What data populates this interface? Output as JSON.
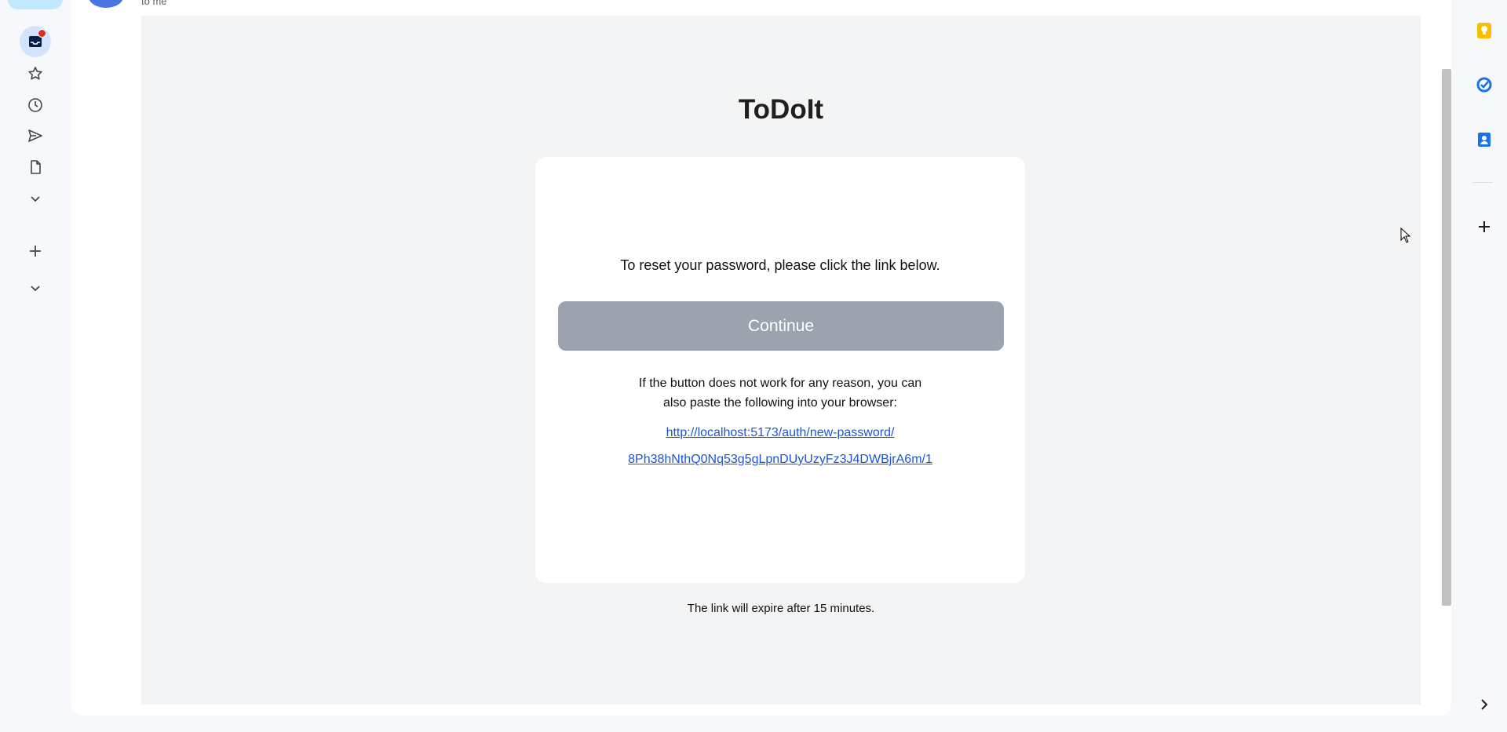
{
  "nav": {
    "items": [
      {
        "icon": "inbox-icon",
        "unread_dot": true
      },
      {
        "icon": "star-icon"
      },
      {
        "icon": "clock-icon"
      },
      {
        "icon": "send-icon"
      },
      {
        "icon": "draft-icon"
      },
      {
        "icon": "chevron-down-icon"
      },
      {
        "icon": "plus-icon"
      },
      {
        "icon": "chevron-down-icon"
      }
    ]
  },
  "message_header": {
    "to": "to me"
  },
  "email": {
    "brand": "ToDoIt",
    "instruction": "To reset your password, please click the link below.",
    "button_label": "Continue",
    "help_line1": "If the button does not work for any reason, you can",
    "help_line2": "also paste the following into your browser:",
    "link_line1": "http://localhost:5173/auth/new-password/",
    "link_line2": "8Ph38hNthQ0Nq53g5gLpnDUyUzyFz3J4DWBjrA6m/1",
    "expiry_note": "The link will expire after 15 minutes."
  },
  "side_panel": {
    "apps": [
      "keep-icon",
      "tasks-icon",
      "contacts-icon",
      "add-icon"
    ],
    "colors": {
      "keep": "#fbbc04",
      "tasks": "#1a73e8",
      "contacts": "#1a73e8"
    }
  }
}
